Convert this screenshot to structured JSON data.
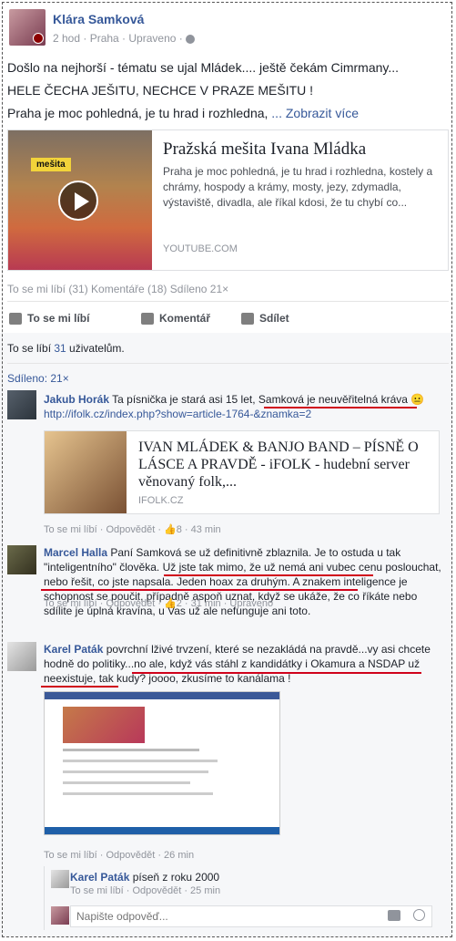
{
  "post": {
    "author": "Klára Samková",
    "meta": "2 hod · Praha · Upraveno · ",
    "lines": [
      "Došlo na nejhorší - tématu se ujal Mládek.... ještě čekám Cimrmany...",
      "HELE ČECHA JEŠITU, NECHCE V PRAZE MEŠITU !",
      "Praha je moc pohledná, je tu hrad i rozhledna, "
    ],
    "see_more": "... Zobrazit více",
    "card": {
      "thumb_label": "mešita",
      "title": "Pražská mešita Ivana Mládka",
      "desc": "Praha je moc pohledná, je tu hrad i rozhledna, kostely a chrámy, hospody a krámy, mosty, jezy, zdymadla, výstaviště, divadla, ale říkal kdosi, že tu chybí co...",
      "source": "YOUTUBE.COM"
    },
    "stats": "To se mi líbí (31)   Komentáře (18)   Sdíleno 21×",
    "actions": {
      "like": "To se mi líbí",
      "comment": "Komentář",
      "share": "Sdílet"
    }
  },
  "likes": {
    "prefix": "To se líbí ",
    "count": "31",
    "suffix": " uživatelům."
  },
  "shared": "Sdíleno: 21×",
  "comments": [
    {
      "name": "Jakub Horák",
      "text": " Ta písnička je stará asi 15 let, Samková je neuvěřitelná kráva 😐",
      "link": "http://ifolk.cz/index.php?show=article-1764-&znamka=2",
      "card_title": "IVAN MLÁDEK & BANJO BAND – PÍSNĚ O LÁSCE A PRAVDĚ - iFOLK - hudební server věnovaný folk,...",
      "card_source": "IFOLK.CZ",
      "actions": "To se mi líbí · Odpovědět · 👍8 · 43 min"
    },
    {
      "name": "Marcel Halla",
      "text": " Paní Samková se už definitivně zblaznila. Je to ostuda u tak \"inteligentního\" člověka. Už jste tak mimo, že už nemá ani vubec cenu poslouchat, nebo řešit, co jste napsala. Jeden hoax za druhým. A znakem inteligence je schopnost se poučit, případně aspoň uznat, když se ukáže, že co říkáte nebo sdílite je úplná kravína, u Vas už ale nefunguje ani toto.",
      "actions": "To se mi líbí · Odpovědět · 👍2 · 31 min · Upraveno"
    },
    {
      "name": "Karel Paták",
      "text": " povrchní lživé trvzení, které se nezakládá na pravdě...vy asi chcete hodně do politiky...no ale, když vás stáhl z kandidátky i Okamura a NSDAP už neexistuje, tak kudy? joooo, zkusíme to kanálama !",
      "actions": "To se mi líbí · Odpovědět · 26 min"
    }
  ],
  "reply": {
    "name": "Karel Paták",
    "text": " píseň z roku 2000",
    "actions": "To se mi líbí · Odpovědět · 25 min"
  },
  "reply_input": {
    "placeholder": "Napište odpověď..."
  }
}
